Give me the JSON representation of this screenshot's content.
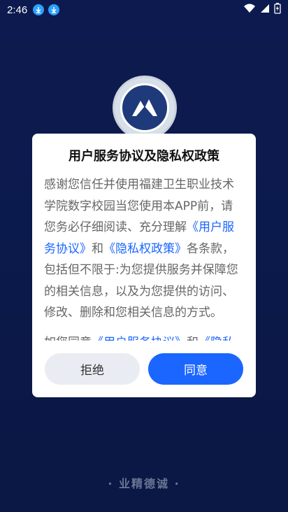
{
  "status_bar": {
    "time": "2:46",
    "download_icons": [
      "download-icon",
      "download-icon"
    ],
    "right_icons": [
      "wifi-icon",
      "signal-icon",
      "battery-icon"
    ]
  },
  "background": {
    "logo_icon": "school-logo-icon",
    "motto": "· 业精德诚 ·"
  },
  "dialog": {
    "title": "用户服务协议及隐私权政策",
    "body_segments": [
      {
        "text": "感谢您信任并使用福建卫生职业技术学院数字校园当您使用本APP前，请您务必仔细阅读、充分理解",
        "link": false
      },
      {
        "text": "《用户服务协议》",
        "link": true
      },
      {
        "text": "和",
        "link": false
      },
      {
        "text": "《隐私权政策》",
        "link": true
      },
      {
        "text": "各条款，包括但不限于:为您提供服务并保障您的相关信息，以及为您提供的访问、修改、删除和您相关信息的方式。",
        "link": false
      },
      {
        "text": "如您同意",
        "link": false
      },
      {
        "text": "《用户服务协议》",
        "link": true
      },
      {
        "text": "和",
        "link": false
      },
      {
        "text": "《隐私",
        "link": true
      }
    ],
    "reject_label": "拒绝",
    "agree_label": "同意"
  },
  "colors": {
    "link": "#1a66ff",
    "agree_button": "#1a66ff",
    "reject_button": "#e9ecf2"
  }
}
